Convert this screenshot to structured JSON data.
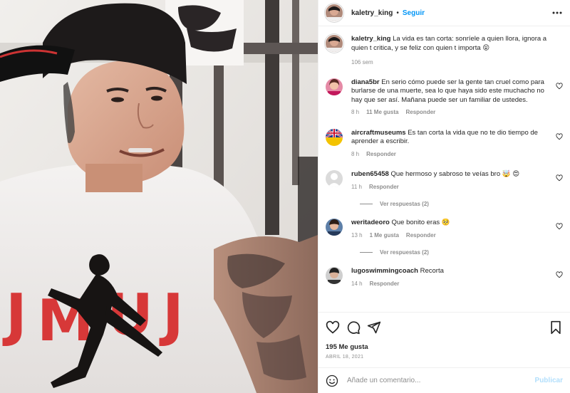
{
  "post": {
    "author": "kaletry_king",
    "follow_label": "Seguir",
    "separator": "•"
  },
  "caption": {
    "username": "kaletry_king",
    "text": "La vida es tan corta: sonríele a quien llora, ignora a quien t critica, y se feliz con quien t importa 😝",
    "time": "106 sem"
  },
  "comments": [
    {
      "username": "diana5br",
      "text": "En serio cómo puede ser la gente tan cruel como para burlarse de una muerte, sea lo que haya sido este muchacho no hay que ser así. Mañana puede ser un familiar de ustedes.",
      "time": "8 h",
      "likes": "11 Me gusta",
      "reply": "Responder"
    },
    {
      "username": "aircraftmuseums",
      "text": "Es tan corta la vida que no te dio tiempo de aprender a escribir.",
      "time": "8 h",
      "reply": "Responder"
    },
    {
      "username": "ruben65458",
      "text": "Que hermoso y sabroso te veías bro 🤯 😍",
      "time": "11 h",
      "reply": "Responder",
      "view_replies": "Ver respuestas (2)"
    },
    {
      "username": "weritadeoro",
      "text": "Que bonito eras 🥺",
      "time": "13 h",
      "likes": "1 Me gusta",
      "reply": "Responder",
      "view_replies": "Ver respuestas (2)"
    },
    {
      "username": "lugoswimmingcoach",
      "text": "Recorta",
      "time": "14 h",
      "reply": "Responder"
    }
  ],
  "engagement": {
    "likes": "195 Me gusta",
    "date": "ABRIL 18, 2021"
  },
  "composer": {
    "placeholder": "Añade un comentario...",
    "publish_label": "Publicar"
  },
  "icons": [
    "more-icon",
    "heart-icon",
    "comment-icon",
    "share-icon",
    "bookmark-icon",
    "emoji-icon"
  ],
  "colors": {
    "accent": "#0095f6",
    "accent_disabled": "#b2dffc",
    "text": "#262626",
    "muted": "#8e8e8e",
    "jersey_red": "#d62a2a"
  }
}
